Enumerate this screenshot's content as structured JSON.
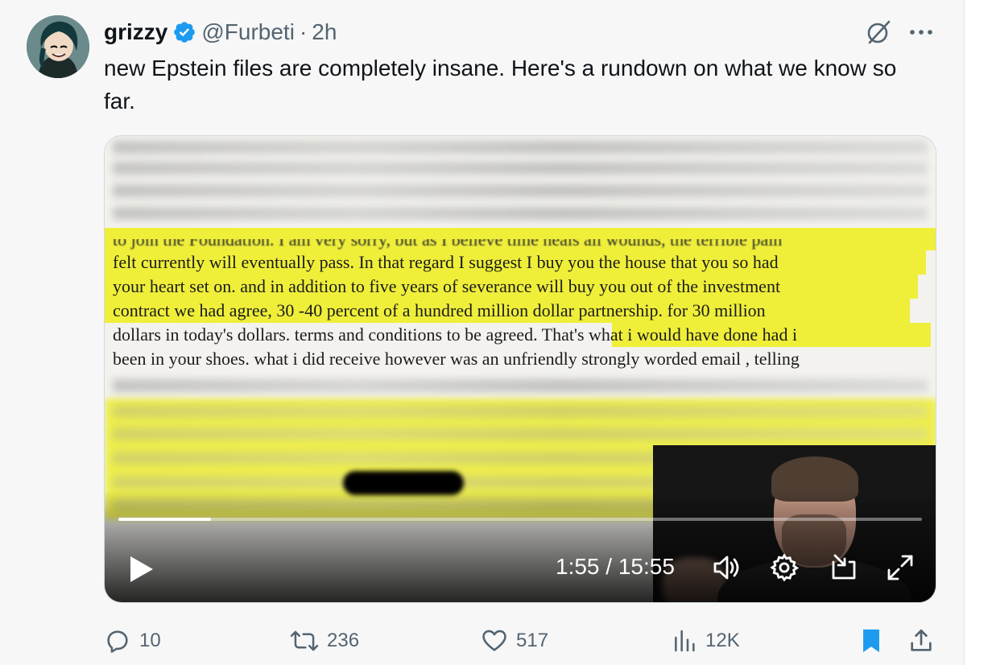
{
  "tweet": {
    "author": {
      "display_name": "grizzy",
      "handle": "@Furbeti",
      "separator": "·",
      "time": "2h",
      "verified": true,
      "avatar_icon": "cartoon-avatar-icon"
    },
    "text": "new Epstein files are completely insane. Here's a rundown on what we know so far.",
    "header_icons": [
      "grok-icon",
      "more-icon"
    ]
  },
  "media": {
    "document_lines": [
      "to join the Foundation.  I am very sorry, but as I believe time heals all wounds,  the terrible pain",
      "felt currently  will eventually pass.  In that regard  I suggest I buy you the house that you so had",
      "your heart set on.  and in addition to five years of severance will buy you out of the investment",
      "contract we had agree,  30 -40 percent of a hundred million dollar partnership.  for 30 million",
      "dollars in today's dollars. terms and conditions to be agreed. That's what i would have done had i",
      "been in your shoes.  what i did receive however was an unfriendly strongly worded email , telling"
    ],
    "highlight_color": "#efef3a",
    "player": {
      "current_time": "1:55",
      "duration": "15:55",
      "time_display": "1:55 / 15:55",
      "progress_fraction": 0.115,
      "icons": [
        "play-icon",
        "volume-icon",
        "settings-icon",
        "picture-in-picture-icon",
        "fullscreen-icon"
      ]
    }
  },
  "actions": {
    "replies": "10",
    "reposts": "236",
    "likes": "517",
    "views": "12K",
    "bookmarked": true,
    "accent_color": "#1d9bf0",
    "icons": [
      "reply-icon",
      "repost-icon",
      "like-icon",
      "views-icon",
      "bookmark-icon",
      "share-icon"
    ]
  }
}
